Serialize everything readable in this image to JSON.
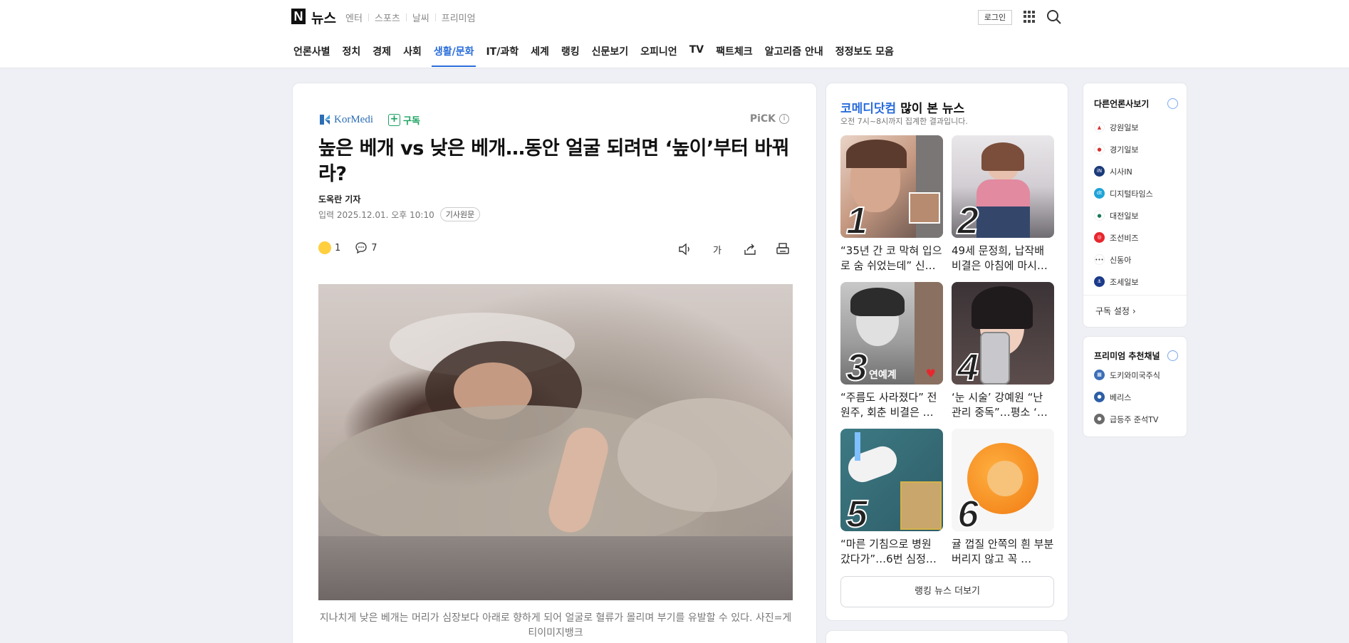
{
  "header": {
    "logo_mark": "N",
    "logo_text": "뉴스",
    "service_links": [
      "엔터",
      "스포츠",
      "날씨",
      "프리미엄"
    ],
    "login_label": "로그인"
  },
  "gnb": {
    "items": [
      "언론사별",
      "정치",
      "경제",
      "사회",
      "생활/문화",
      "IT/과학",
      "세계",
      "랭킹",
      "신문보기",
      "오피니언",
      "TV",
      "팩트체크",
      "알고리즘 안내",
      "정정보도 모음"
    ],
    "active": "생활/문화"
  },
  "article": {
    "press_name": "KorMedi",
    "subscribe_label": "구독",
    "pick_label": "PiCK",
    "headline": "높은 베개 vs 낮은 베개…동안 얼굴 되려면 ‘높이’부터 바꿔라?",
    "reporter": "도옥란 기자",
    "date": "입력 2025.12.01. 오후 10:10",
    "original_label": "기사원문",
    "reaction_count": "1",
    "comment_count": "7",
    "font_tool_label": "가",
    "caption": "지나치게 낮은 베개는 머리가 심장보다 아래로 향하게 되어 얼굴로 혈류가 몰리며 부기를 유발할 수 있다. 사진=게티이미지뱅크"
  },
  "ranking": {
    "title_press": "코메디닷컴",
    "title_rest": " 많이 본 뉴스",
    "subtitle": "오전 7시~8시까지 집계한 결과입니다.",
    "items": [
      {
        "num": "1",
        "text": "“35년 간 코 막혀 입으로 숨 쉬었는데” 신…"
      },
      {
        "num": "2",
        "text": "49세 문정희, 납작배 비결은 아침에 마시…"
      },
      {
        "num": "3",
        "text": "“주름도 사라졌다” 전원주, 회춘 비결은 …"
      },
      {
        "num": "4",
        "text": "‘눈 시술’ 강예원 “난 관리 중독”…평소 ‘…"
      },
      {
        "num": "5",
        "text": "“마른 기침으로 병원 갔다가”…6번 심정…"
      },
      {
        "num": "6",
        "text": "귤 껍질 안쪽의 흰 부분 버리지 않고 꼭 …"
      }
    ],
    "thumb_overlay_3": "연예계",
    "more_label": "랭킹 뉴스 더보기"
  },
  "side_press": {
    "title": "다른언론사보기",
    "items": [
      {
        "name": "강원일보",
        "color": "#ffffff",
        "fg": "#d9302f"
      },
      {
        "name": "경기일보",
        "color": "#ffffff",
        "fg": "#d9302f"
      },
      {
        "name": "시사IN",
        "color": "#1a3a7a",
        "fg": "#ffffff"
      },
      {
        "name": "디지털타임스",
        "color": "#1fa4d8",
        "fg": "#ffffff"
      },
      {
        "name": "대전일보",
        "color": "#ffffff",
        "fg": "#1a7a55"
      },
      {
        "name": "조선비즈",
        "color": "#e8262e",
        "fg": "#ffffff"
      },
      {
        "name": "신동아",
        "color": "#ffffff",
        "fg": "#444444"
      },
      {
        "name": "조세일보",
        "color": "#1b3a8a",
        "fg": "#ffffff"
      }
    ],
    "setting_label": "구독 설정"
  },
  "side_premium": {
    "title": "프리미엄 추천채널",
    "items": [
      {
        "name": "도키와미국주식",
        "color": "#3d6fb8"
      },
      {
        "name": "베리스",
        "color": "#2c5fa6"
      },
      {
        "name": "급등주 준석TV",
        "color": "#6b6b6b"
      }
    ]
  }
}
